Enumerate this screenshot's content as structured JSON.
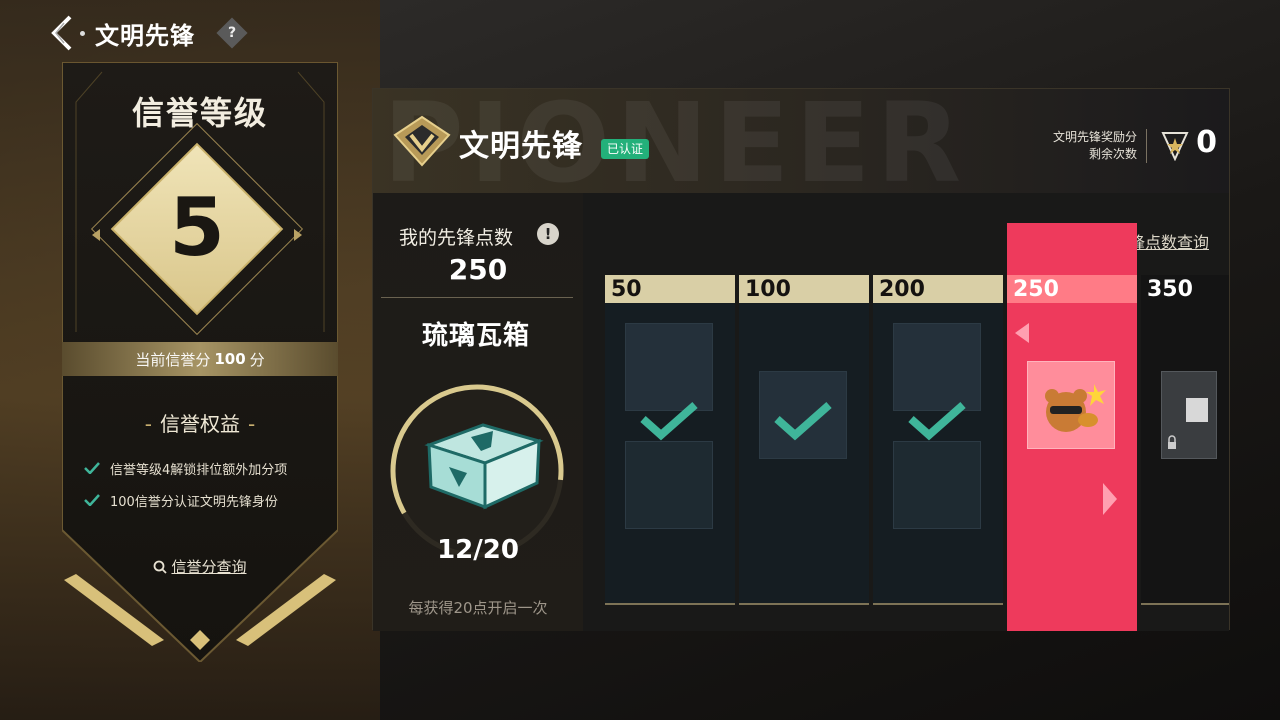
{
  "top_bar": {
    "title": "文明先锋",
    "help_label": "?"
  },
  "credit_panel": {
    "title": "信誉等级",
    "level": "5",
    "score_prefix": "当前信誉分",
    "score_value": "100",
    "score_suffix": "分",
    "rights_title": "信誉权益",
    "rights": [
      "信誉等级4解锁排位额外加分项",
      "100信誉分认证文明先锋身份"
    ],
    "query_label": "信誉分查询"
  },
  "main": {
    "bg_word": "PIONEER",
    "title": "文明先锋",
    "verified_label": "已认证",
    "reward_info_line1": "文明先锋奖励分",
    "reward_info_line2": "剩余次数",
    "reward_count": "0",
    "my_points_label": "我的先锋点数",
    "info_label": "!",
    "my_points_value": "250",
    "box_name": "琉璃瓦箱",
    "progress_text": "12/20",
    "progress_fraction": 0.6,
    "progress_hint": "每获得20点开启一次",
    "points_query_label": "文明先锋点数查询",
    "track": [
      {
        "points": "50",
        "state": "claimed"
      },
      {
        "points": "100",
        "state": "claimed"
      },
      {
        "points": "200",
        "state": "claimed"
      },
      {
        "points": "250",
        "state": "current"
      },
      {
        "points": "350",
        "state": "locked"
      }
    ]
  },
  "colors": {
    "gold": "#d9cfa6",
    "current_pink": "#ee3a5c",
    "verified_green": "#23b07a",
    "check_teal": "#3fb59a"
  }
}
